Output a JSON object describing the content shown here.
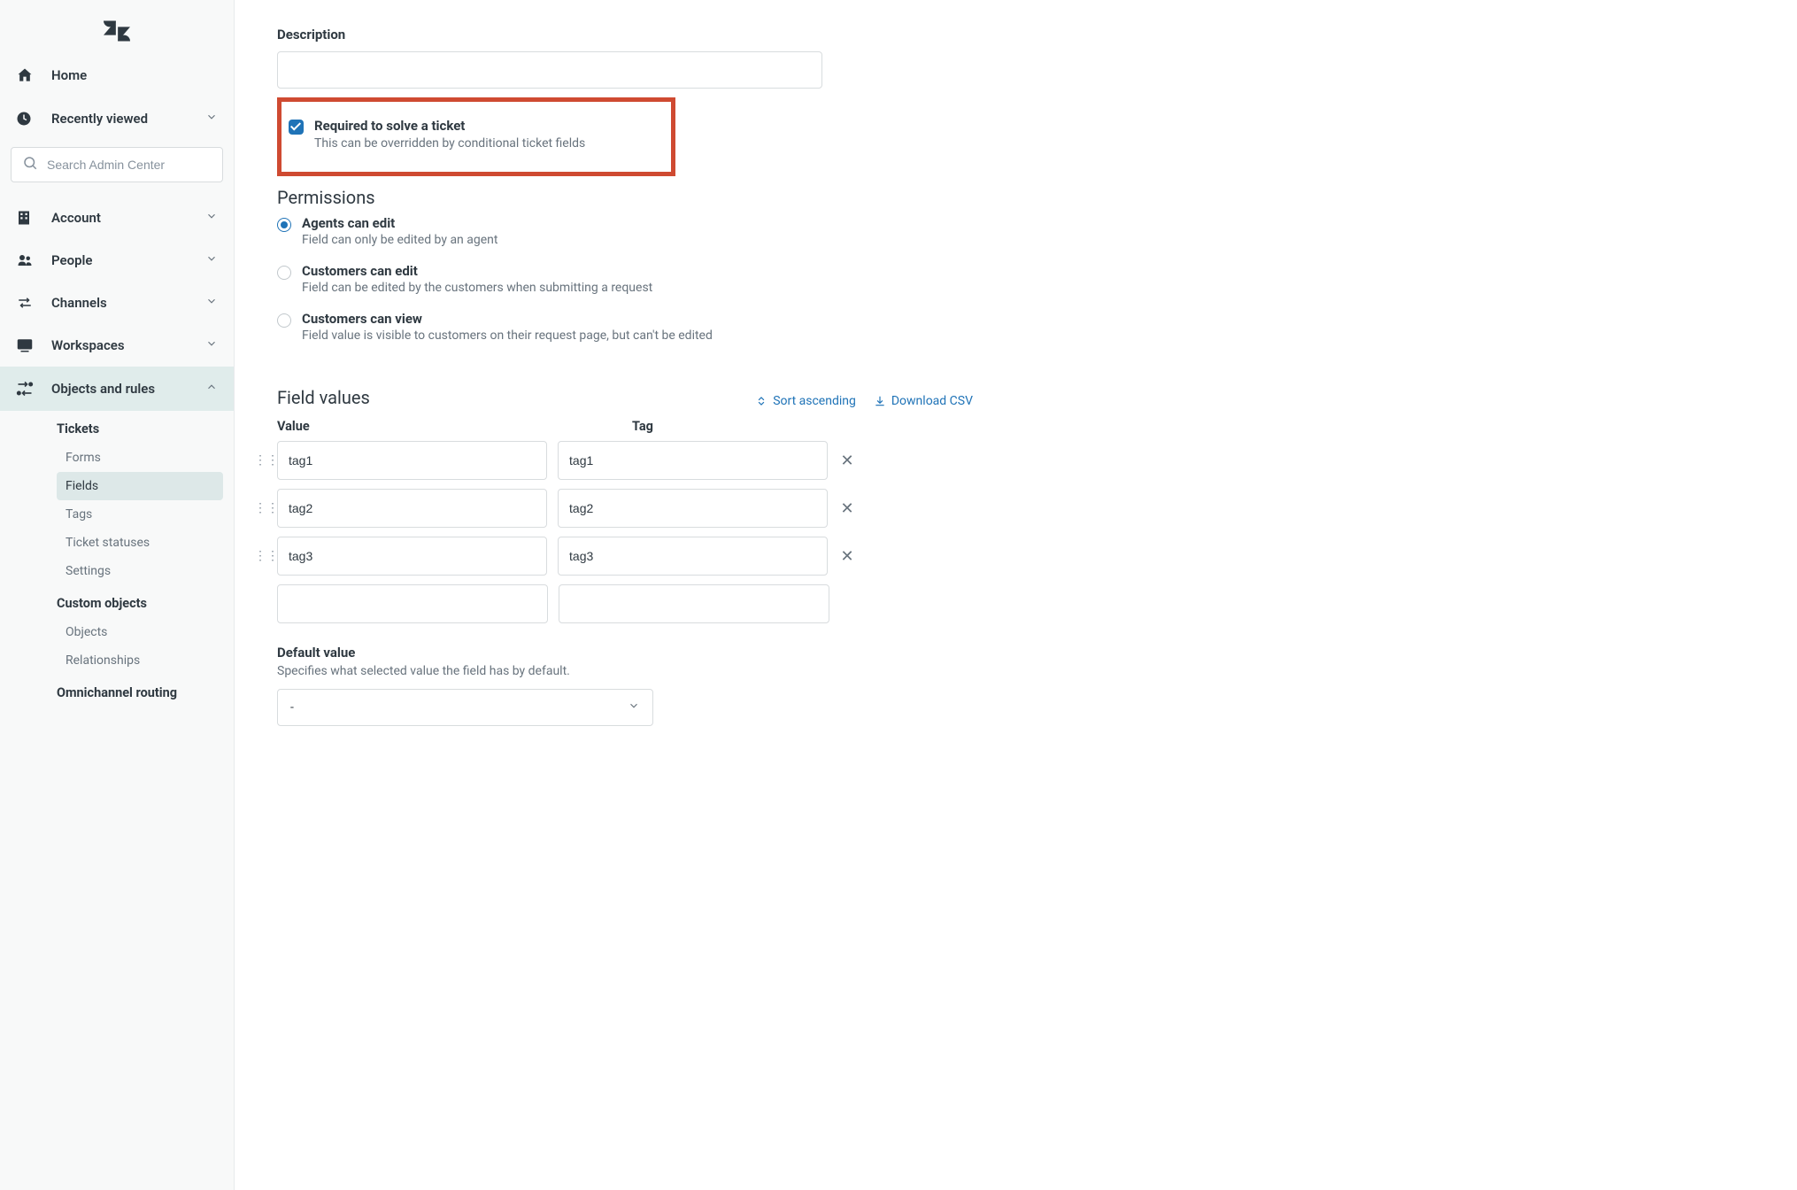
{
  "sidebar": {
    "items": {
      "home": "Home",
      "recent": "Recently viewed",
      "account": "Account",
      "people": "People",
      "channels": "Channels",
      "workspaces": "Workspaces",
      "objects": "Objects and rules"
    },
    "search_placeholder": "Search Admin Center",
    "sub": {
      "tickets": "Tickets",
      "forms": "Forms",
      "fields": "Fields",
      "tags": "Tags",
      "statuses": "Ticket statuses",
      "settings": "Settings",
      "custom_objects": "Custom objects",
      "objects": "Objects",
      "relationships": "Relationships",
      "omnichannel": "Omnichannel routing"
    }
  },
  "main": {
    "description_label": "Description",
    "required": {
      "title": "Required to solve a ticket",
      "sub": "This can be overridden by conditional ticket fields"
    },
    "permissions": {
      "heading": "Permissions",
      "agents_edit": {
        "title": "Agents can edit",
        "sub": "Field can only be edited by an agent"
      },
      "customers_edit": {
        "title": "Customers can edit",
        "sub": "Field can be edited by the customers when submitting a request"
      },
      "customers_view": {
        "title": "Customers can view",
        "sub": "Field value is visible to customers on their request page, but can't be edited"
      }
    },
    "field_values": {
      "heading": "Field values",
      "sort_asc": "Sort ascending",
      "download": "Download CSV",
      "value_col": "Value",
      "tag_col": "Tag",
      "rows": [
        {
          "value": "tag1",
          "tag": "tag1"
        },
        {
          "value": "tag2",
          "tag": "tag2"
        },
        {
          "value": "tag3",
          "tag": "tag3"
        }
      ]
    },
    "default_value": {
      "heading": "Default value",
      "sub": "Specifies what selected value the field has by default.",
      "selected": "-"
    }
  }
}
